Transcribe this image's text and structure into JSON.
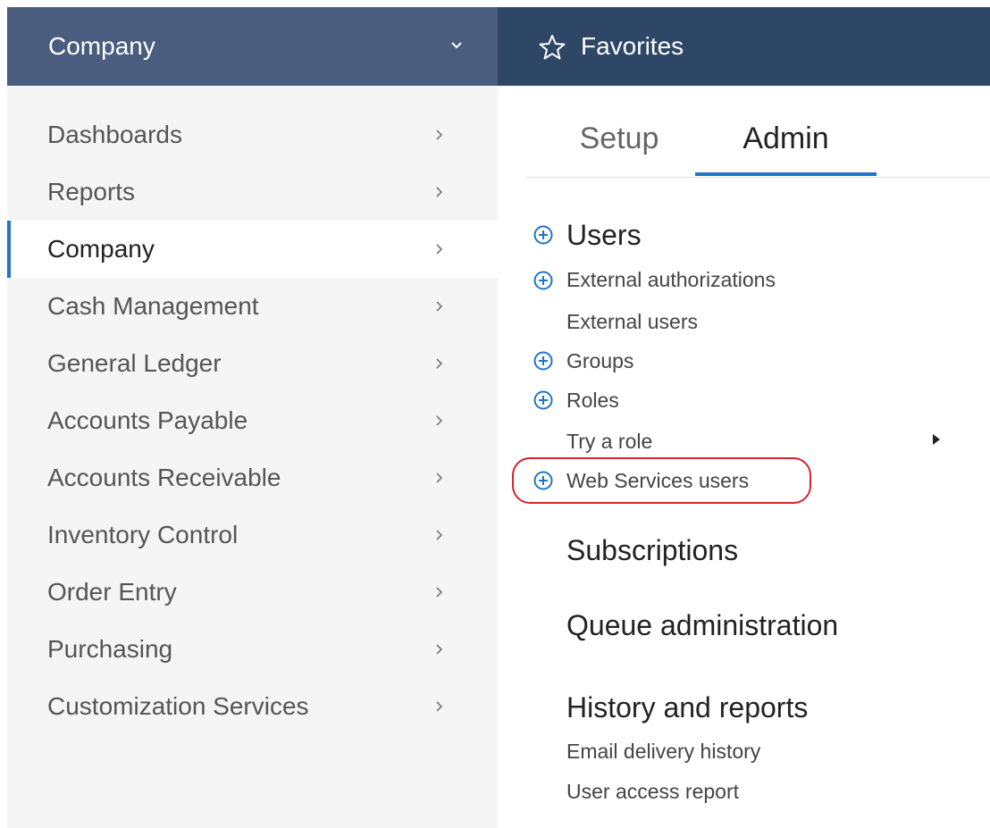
{
  "header": {
    "menu_title": "Company",
    "favorites_label": "Favorites"
  },
  "menu": {
    "items": [
      {
        "label": "Dashboards",
        "active": false
      },
      {
        "label": "Reports",
        "active": false
      },
      {
        "label": "Company",
        "active": true
      },
      {
        "label": "Cash Management",
        "active": false
      },
      {
        "label": "General Ledger",
        "active": false
      },
      {
        "label": "Accounts Payable",
        "active": false
      },
      {
        "label": "Accounts Receivable",
        "active": false
      },
      {
        "label": "Inventory Control",
        "active": false
      },
      {
        "label": "Order Entry",
        "active": false
      },
      {
        "label": "Purchasing",
        "active": false
      },
      {
        "label": "Customization Services",
        "active": false
      }
    ]
  },
  "tabs": {
    "setup": "Setup",
    "admin": "Admin",
    "selected": "Admin"
  },
  "admin": {
    "users_title": "Users",
    "users_links": [
      "External authorizations",
      "External users",
      "Groups",
      "Roles",
      "Try a role",
      "Web Services users"
    ],
    "subscriptions_title": "Subscriptions",
    "queue_title": "Queue administration",
    "history_title": "History and reports",
    "history_links": [
      "Email delivery history",
      "User access report"
    ]
  },
  "colors": {
    "header_left": "#4a5d7e",
    "header_right": "#2e4766",
    "accent": "#1f74c8",
    "highlight": "#d4242f"
  }
}
